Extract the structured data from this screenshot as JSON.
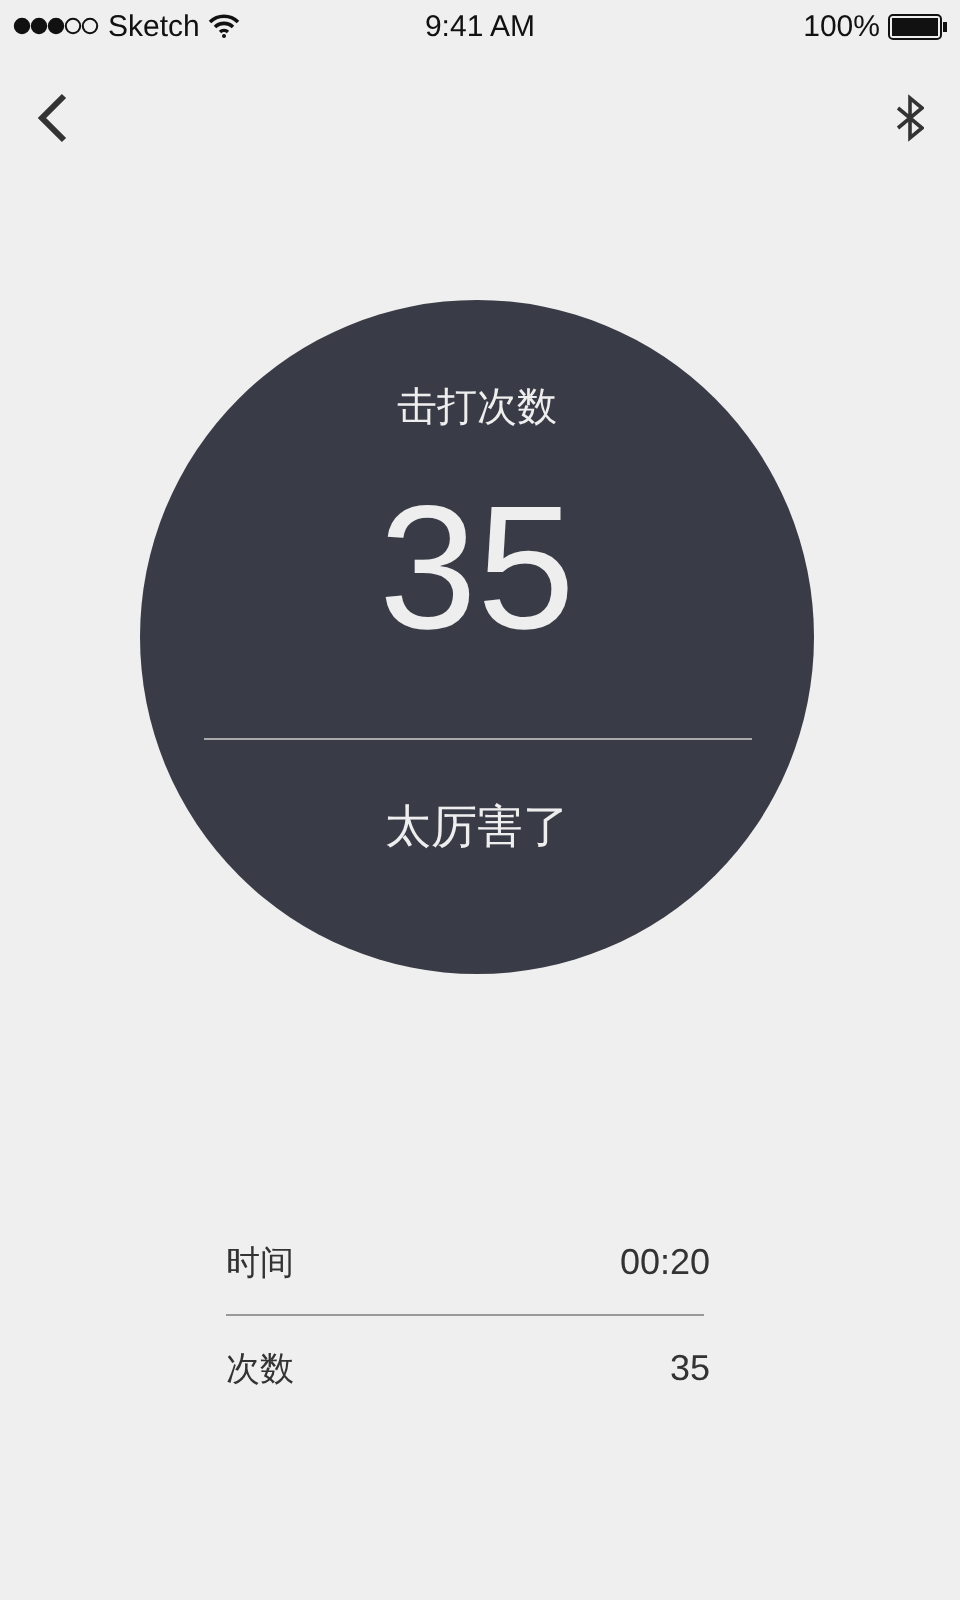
{
  "status_bar": {
    "carrier": "Sketch",
    "time": "9:41 AM",
    "battery": "100%"
  },
  "score": {
    "title": "击打次数",
    "value": "35",
    "message": "太厉害了"
  },
  "stats": [
    {
      "label": "时间",
      "value": "00:20"
    },
    {
      "label": "次数",
      "value": "35"
    }
  ]
}
